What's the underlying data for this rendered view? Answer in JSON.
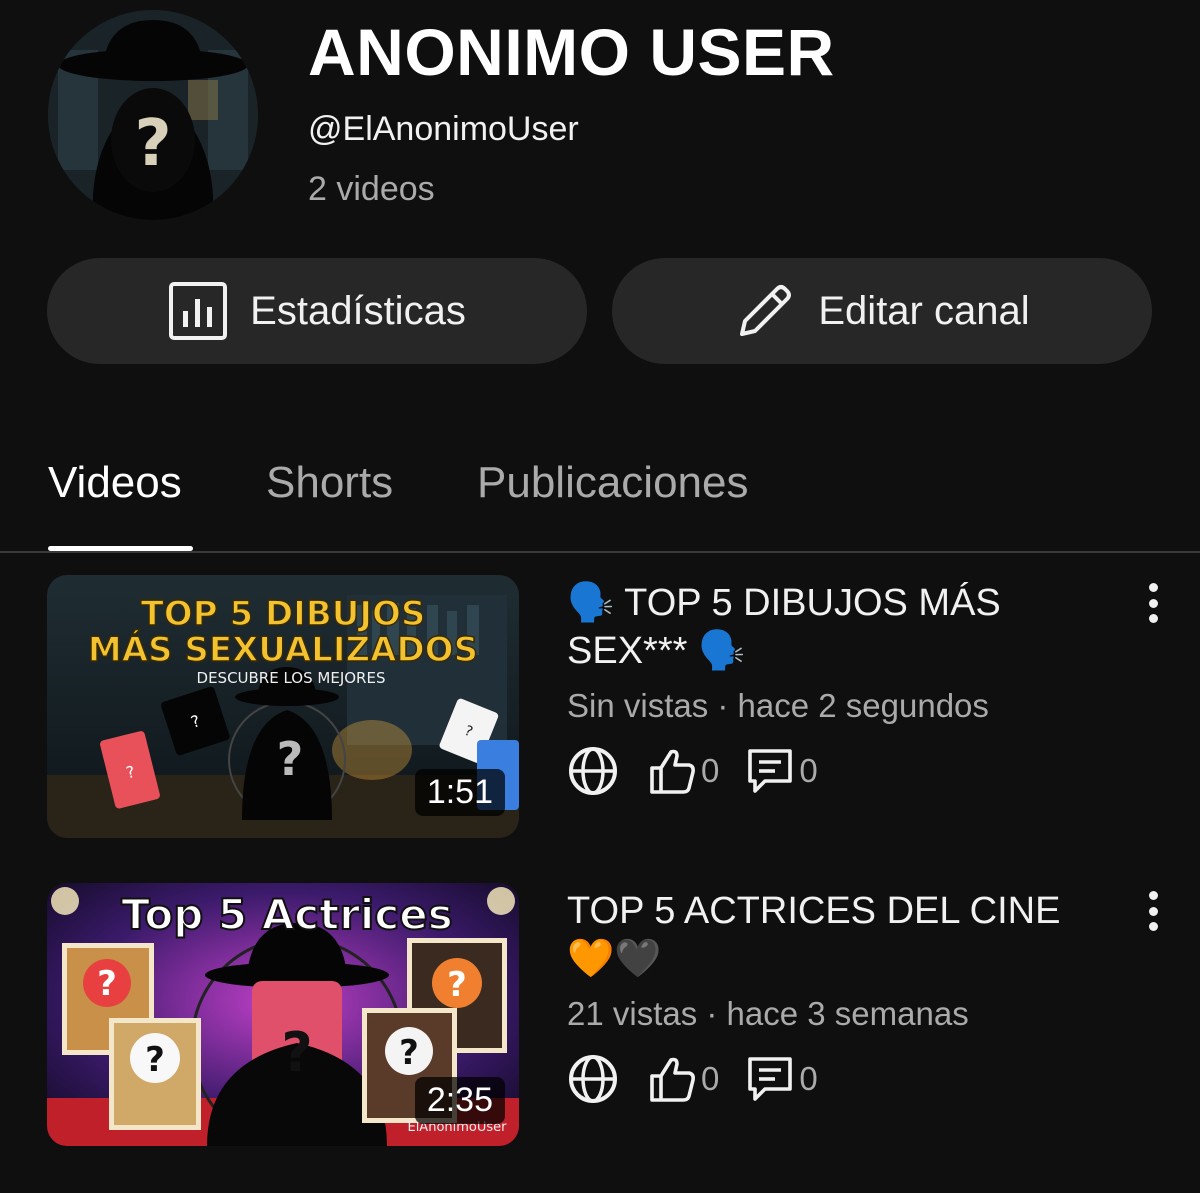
{
  "channel": {
    "name": "ANONIMO USER",
    "handle": "@ElAnonimoUser",
    "video_count": "2 videos"
  },
  "actions": {
    "stats_label": "Estadísticas",
    "edit_label": "Editar canal"
  },
  "tabs": [
    {
      "label": "Videos",
      "selected": true
    },
    {
      "label": "Shorts",
      "selected": false
    },
    {
      "label": "Publicaciones",
      "selected": false
    }
  ],
  "videos": [
    {
      "title": "🗣️ TOP 5 DIBUJOS MÁS SEX*** 🗣️",
      "meta": "Sin vistas · hace 2 segundos",
      "duration": "1:51",
      "likes": "0",
      "comments": "0",
      "thumb_text": {
        "line1": "TOP 5 DIBUJOS",
        "line2": "MÁS SEXUALIZADOS",
        "line3": "DESCUBRE LOS MEJORES"
      }
    },
    {
      "title": "TOP 5 ACTRICES DEL CINE 🧡🖤",
      "meta": "21 vistas · hace 3 semanas",
      "duration": "2:35",
      "likes": "0",
      "comments": "0",
      "thumb_text": {
        "line1": "Top 5 Actrices",
        "watermark": "ElAnonimoUser"
      }
    }
  ],
  "colors": {
    "background": "#0f0f0f",
    "button_bg": "#272727",
    "text_primary": "#f1f1f1",
    "text_secondary": "#aaaaaa",
    "thumb1_title": "#f2c230"
  },
  "icons": {
    "stats": "bar-chart-icon",
    "edit": "pencil-icon",
    "visibility": "globe-icon",
    "likes": "thumbs-up-icon",
    "comments": "comment-icon",
    "menu": "kebab-menu-icon"
  }
}
